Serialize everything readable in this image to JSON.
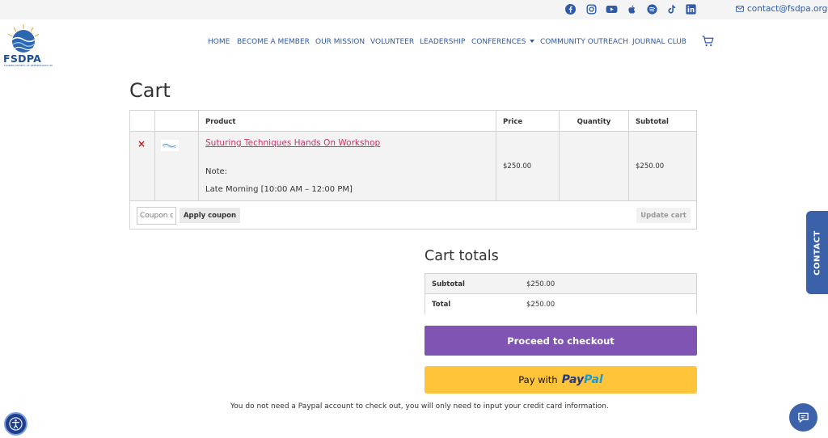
{
  "topbar": {
    "social": [
      {
        "icon": "facebook-icon",
        "color": "#2e5aa8"
      },
      {
        "icon": "instagram-icon",
        "color": "#2e5aa8"
      },
      {
        "icon": "youtube-icon",
        "color": "#2e5aa8"
      },
      {
        "icon": "apple-icon",
        "color": "#2e5aa8"
      },
      {
        "icon": "spotify-icon",
        "color": "#2e5aa8"
      },
      {
        "icon": "tiktok-icon",
        "color": "#2e5aa8"
      },
      {
        "icon": "linkedin-icon",
        "color": "#2e5aa8"
      }
    ],
    "email": "contact@fsdpa.org"
  },
  "logo": {
    "text": "FSDPA",
    "subtitle": "FLORIDA SOCIETY OF DERMATOLOGY PA"
  },
  "nav": {
    "items": [
      {
        "label": "HOME"
      },
      {
        "label": "BECOME A MEMBER"
      },
      {
        "label": "OUR MISSION"
      },
      {
        "label": "VOLUNTEER"
      },
      {
        "label": "LEADERSHIP"
      },
      {
        "label": "CONFERENCES",
        "has_dropdown": true
      },
      {
        "label": "COMMUNITY OUTREACH"
      },
      {
        "label": "JOURNAL CLUB"
      }
    ]
  },
  "cart": {
    "title": "Cart",
    "headers": {
      "product": "Product",
      "price": "Price",
      "quantity": "Quantity",
      "subtotal": "Subtotal"
    },
    "item": {
      "remove": "×",
      "name": "Suturing Techniques Hands On Workshop",
      "note_label": "Note:",
      "note_value": "Late Morning [10:00 AM – 12:00 PM]",
      "price": "$250.00",
      "quantity": "",
      "subtotal": "$250.00"
    },
    "coupon_placeholder": "Coupon code",
    "apply_coupon": "Apply coupon",
    "update_cart": "Update cart"
  },
  "totals": {
    "title": "Cart totals",
    "subtotal_label": "Subtotal",
    "subtotal_value": "$250.00",
    "total_label": "Total",
    "total_value": "$250.00",
    "checkout_label": "Proceed to checkout",
    "paypal_with": "Pay with",
    "paypal_pay": "Pay",
    "paypal_pal": "Pal",
    "paypal_note": "You do not need a Paypal account to check out, you will only need to input your credit card information."
  },
  "widgets": {
    "contact_tab": "CONTACT"
  },
  "colors": {
    "brand_blue": "#2e5aa8",
    "checkout_purple": "#7f54b3",
    "paypal_yellow": "#ffc439",
    "link_pink": "#c8346d",
    "remove_red": "#c21b1b"
  }
}
